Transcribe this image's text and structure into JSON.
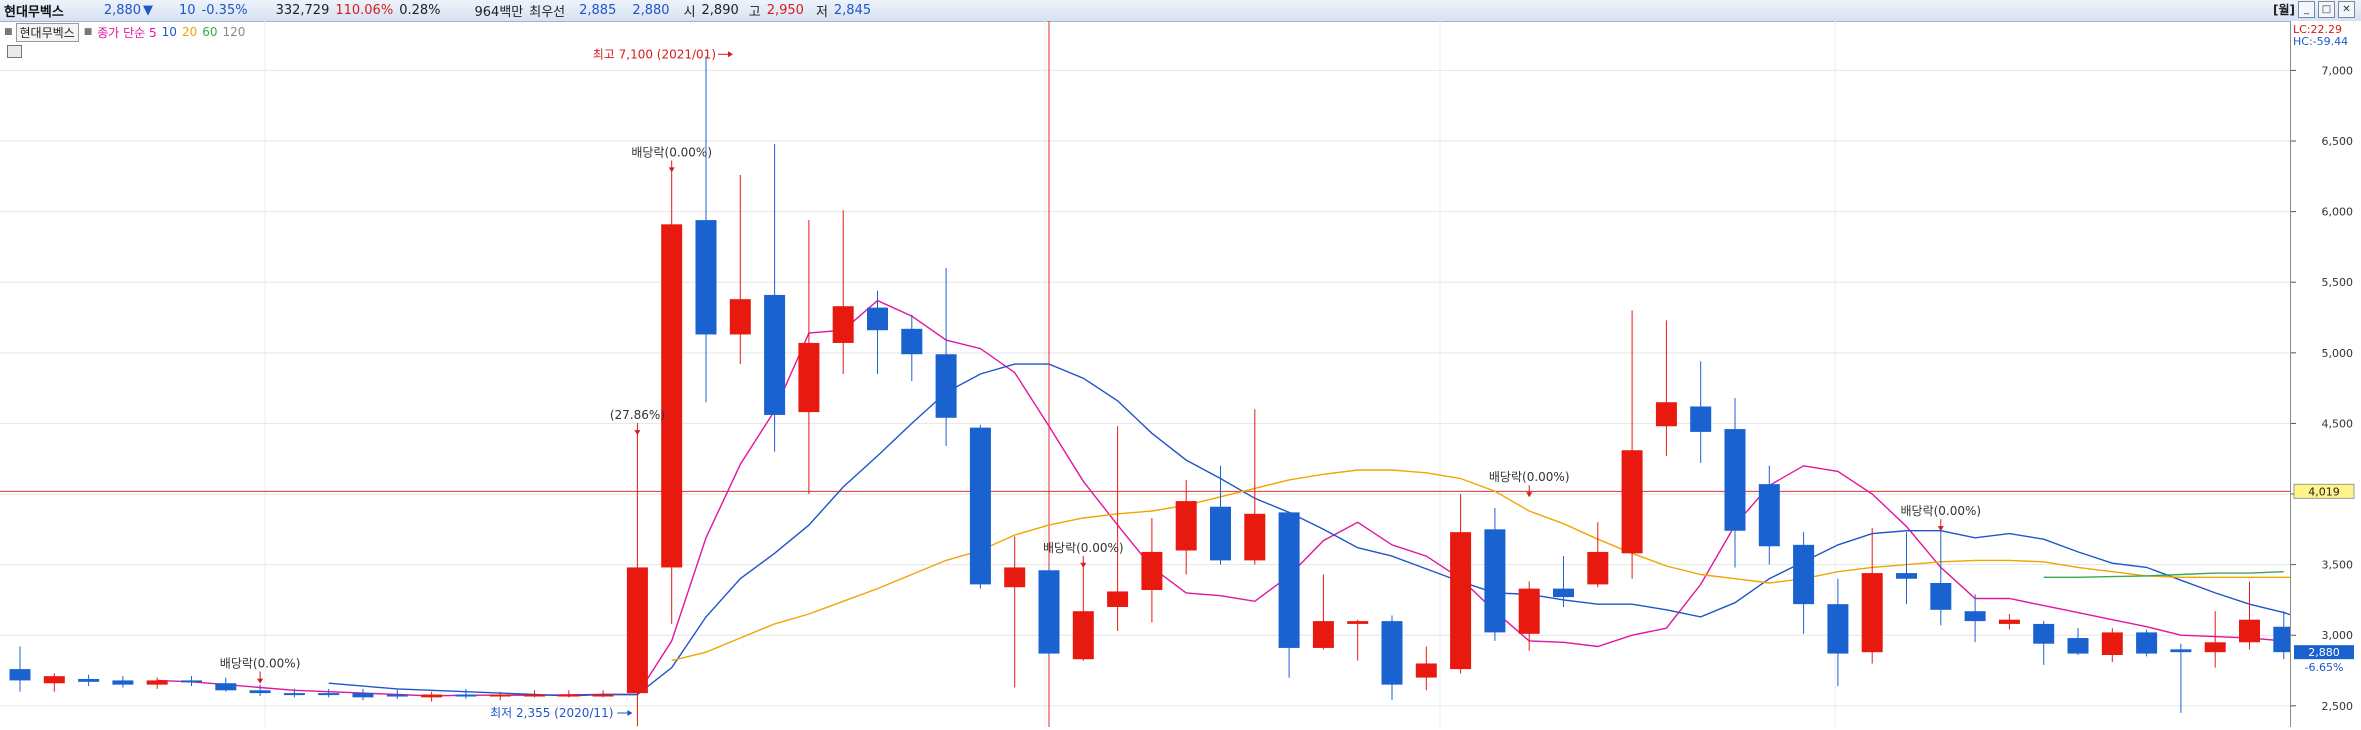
{
  "header": {
    "symbol": "현대무벡스",
    "price": "2,880",
    "direction_icon": "down-triangle-icon",
    "direction_glyph": "▼",
    "change": "10",
    "change_pct": "-0.35%",
    "volume": "332,729",
    "volume_ratio": "110.06%",
    "turnover": "0.28%",
    "amount": "964백만",
    "best_ask_label": "최우선",
    "best_ask": "2,885",
    "best_bid": "2,880",
    "open_label": "시",
    "open": "2,890",
    "high_label": "고",
    "high": "2,950",
    "low_label": "저",
    "low": "2,845",
    "period_button": "[월]",
    "window_buttons": [
      "_",
      "□",
      "✕"
    ]
  },
  "legend": {
    "symbol_tag": "현대무벡스",
    "ma_label": "종가 단순 5",
    "ma_periods": [
      "10",
      "20",
      "60",
      "120"
    ],
    "colors": {
      "ma5": "#e2159f",
      "ma10": "#1f55c8",
      "ma20": "#f0a500",
      "ma60": "#3aa84a",
      "ma120": "#8a8a8a"
    }
  },
  "axis_info": {
    "lc": "LC:22.29",
    "hc": "HC:-59.44"
  },
  "current_price_tag": {
    "value": "2,880",
    "pct": "-6.65%"
  },
  "crosshair_tag": "4,019",
  "chart_data": {
    "type": "candlestick",
    "period": "monthly",
    "ylim": [
      2350,
      7350
    ],
    "yticks": [
      "2,500",
      "3,000",
      "3,500",
      "4,000",
      "4,500",
      "5,000",
      "5,500",
      "6,000",
      "6,500",
      "7,000"
    ],
    "ytick_values": [
      2500,
      3000,
      3500,
      4000,
      4500,
      5000,
      5500,
      6000,
      6500,
      7000
    ],
    "up_color": "#e8190f",
    "down_color": "#1a62d0",
    "candles": [
      {
        "o": 2760,
        "h": 2920,
        "l": 2600,
        "c": 2680
      },
      {
        "o": 2660,
        "h": 2730,
        "l": 2600,
        "c": 2710
      },
      {
        "o": 2690,
        "h": 2720,
        "l": 2640,
        "c": 2670
      },
      {
        "o": 2680,
        "h": 2710,
        "l": 2630,
        "c": 2650
      },
      {
        "o": 2650,
        "h": 2700,
        "l": 2620,
        "c": 2680
      },
      {
        "o": 2680,
        "h": 2710,
        "l": 2640,
        "c": 2670
      },
      {
        "o": 2660,
        "h": 2700,
        "l": 2600,
        "c": 2610
      },
      {
        "o": 2610,
        "h": 2650,
        "l": 2570,
        "c": 2590
      },
      {
        "o": 2590,
        "h": 2620,
        "l": 2560,
        "c": 2580
      },
      {
        "o": 2590,
        "h": 2620,
        "l": 2560,
        "c": 2580
      },
      {
        "o": 2590,
        "h": 2620,
        "l": 2540,
        "c": 2560
      },
      {
        "o": 2580,
        "h": 2620,
        "l": 2550,
        "c": 2570
      },
      {
        "o": 2560,
        "h": 2600,
        "l": 2530,
        "c": 2580
      },
      {
        "o": 2580,
        "h": 2620,
        "l": 2550,
        "c": 2570
      },
      {
        "o": 2570,
        "h": 2600,
        "l": 2540,
        "c": 2580
      },
      {
        "o": 2580,
        "h": 2610,
        "l": 2560,
        "c": 2580
      },
      {
        "o": 2580,
        "h": 2610,
        "l": 2560,
        "c": 2580
      },
      {
        "o": 2580,
        "h": 2610,
        "l": 2560,
        "c": 2580
      },
      {
        "o": 2590,
        "h": 4450,
        "l": 2355,
        "c": 3480
      },
      {
        "o": 3480,
        "h": 6300,
        "l": 3080,
        "c": 5910
      },
      {
        "o": 5940,
        "h": 7100,
        "l": 4650,
        "c": 5130
      },
      {
        "o": 5130,
        "h": 6260,
        "l": 4920,
        "c": 5380
      },
      {
        "o": 5410,
        "h": 6480,
        "l": 4300,
        "c": 4560
      },
      {
        "o": 4580,
        "h": 5940,
        "l": 4000,
        "c": 5070
      },
      {
        "o": 5070,
        "h": 6010,
        "l": 4850,
        "c": 5330
      },
      {
        "o": 5320,
        "h": 5440,
        "l": 4850,
        "c": 5160
      },
      {
        "o": 5170,
        "h": 5270,
        "l": 4800,
        "c": 4990
      },
      {
        "o": 4990,
        "h": 5600,
        "l": 4340,
        "c": 4540
      },
      {
        "o": 4470,
        "h": 4490,
        "l": 3330,
        "c": 3360
      },
      {
        "o": 3340,
        "h": 3700,
        "l": 2630,
        "c": 3480
      },
      {
        "o": 3460,
        "h": 3470,
        "l": 2850,
        "c": 2870
      },
      {
        "o": 2830,
        "h": 3500,
        "l": 2820,
        "c": 3170
      },
      {
        "o": 3200,
        "h": 4480,
        "l": 3030,
        "c": 3310
      },
      {
        "o": 3320,
        "h": 3830,
        "l": 3090,
        "c": 3590
      },
      {
        "o": 3600,
        "h": 4100,
        "l": 3430,
        "c": 3950
      },
      {
        "o": 3910,
        "h": 4200,
        "l": 3500,
        "c": 3530
      },
      {
        "o": 3530,
        "h": 4600,
        "l": 3500,
        "c": 3860
      },
      {
        "o": 3870,
        "h": 3870,
        "l": 2700,
        "c": 2910
      },
      {
        "o": 2910,
        "h": 3430,
        "l": 2900,
        "c": 3100
      },
      {
        "o": 3080,
        "h": 3110,
        "l": 2820,
        "c": 3100
      },
      {
        "o": 3100,
        "h": 3140,
        "l": 2540,
        "c": 2650
      },
      {
        "o": 2700,
        "h": 2920,
        "l": 2610,
        "c": 2800
      },
      {
        "o": 2760,
        "h": 4000,
        "l": 2730,
        "c": 3730
      },
      {
        "o": 3750,
        "h": 3900,
        "l": 2960,
        "c": 3020
      },
      {
        "o": 3010,
        "h": 3380,
        "l": 2890,
        "c": 3330
      },
      {
        "o": 3330,
        "h": 3560,
        "l": 3200,
        "c": 3270
      },
      {
        "o": 3360,
        "h": 3800,
        "l": 3340,
        "c": 3590
      },
      {
        "o": 3580,
        "h": 5300,
        "l": 3400,
        "c": 4310
      },
      {
        "o": 4480,
        "h": 5230,
        "l": 4270,
        "c": 4650
      },
      {
        "o": 4620,
        "h": 4940,
        "l": 4220,
        "c": 4440
      },
      {
        "o": 4460,
        "h": 4680,
        "l": 3480,
        "c": 3740
      },
      {
        "o": 4070,
        "h": 4200,
        "l": 3500,
        "c": 3630
      },
      {
        "o": 3640,
        "h": 3730,
        "l": 3010,
        "c": 3220
      },
      {
        "o": 3220,
        "h": 3400,
        "l": 2640,
        "c": 2870
      },
      {
        "o": 2880,
        "h": 3760,
        "l": 2800,
        "c": 3440
      },
      {
        "o": 3440,
        "h": 3730,
        "l": 3220,
        "c": 3400
      },
      {
        "o": 3370,
        "h": 3760,
        "l": 3070,
        "c": 3180
      },
      {
        "o": 3170,
        "h": 3290,
        "l": 2950,
        "c": 3100
      },
      {
        "o": 3080,
        "h": 3150,
        "l": 3040,
        "c": 3110
      },
      {
        "o": 3080,
        "h": 3100,
        "l": 2790,
        "c": 2940
      },
      {
        "o": 2980,
        "h": 3050,
        "l": 2860,
        "c": 2870
      },
      {
        "o": 2860,
        "h": 3050,
        "l": 2810,
        "c": 3020
      },
      {
        "o": 3020,
        "h": 3040,
        "l": 2850,
        "c": 2870
      },
      {
        "o": 2900,
        "h": 2940,
        "l": 2450,
        "c": 2880
      },
      {
        "o": 2880,
        "h": 3170,
        "l": 2770,
        "c": 2950
      },
      {
        "o": 2950,
        "h": 3380,
        "l": 2900,
        "c": 3110
      },
      {
        "o": 3060,
        "h": 3170,
        "l": 2830,
        "c": 2880
      }
    ],
    "ma_series": [
      {
        "name": "5",
        "color": "#e2159f",
        "start": 4,
        "values": [
          2680,
          2670,
          2650,
          2630,
          2610,
          2600,
          2590,
          2580,
          2570,
          2575,
          2575,
          2575,
          2578,
          2580,
          2580,
          2960,
          3690,
          4210,
          4590,
          5140,
          5160,
          5370,
          5260,
          5090,
          5030,
          4860,
          4480,
          4090,
          3780,
          3480,
          3300,
          3280,
          3240,
          3420,
          3670,
          3800,
          3640,
          3560,
          3400,
          3170,
          2960,
          2950,
          2920,
          3000,
          3050,
          3360,
          3780,
          4060,
          4200,
          4160,
          4000,
          3770,
          3480,
          3260,
          3260,
          3210,
          3160,
          3110,
          3060,
          3000,
          2990,
          2980,
          2960,
          2970,
          3040,
          3020
        ]
      },
      {
        "name": "10",
        "color": "#1f55c8",
        "start": 9,
        "values": [
          2660,
          2640,
          2620,
          2610,
          2600,
          2590,
          2580,
          2570,
          2580,
          2580,
          2770,
          3130,
          3400,
          3580,
          3780,
          4050,
          4270,
          4500,
          4720,
          4850,
          4920,
          4920,
          4820,
          4660,
          4430,
          4240,
          4110,
          3970,
          3870,
          3750,
          3620,
          3560,
          3470,
          3380,
          3300,
          3290,
          3250,
          3220,
          3220,
          3180,
          3130,
          3230,
          3400,
          3520,
          3640,
          3720,
          3740,
          3740,
          3690,
          3720,
          3680,
          3590,
          3510,
          3480,
          3390,
          3300,
          3220,
          3160,
          3080,
          3050,
          3000,
          2950,
          2960,
          2940,
          2940
        ]
      },
      {
        "name": "20",
        "color": "#f0a500",
        "start": 19,
        "values": [
          2820,
          2880,
          2980,
          3080,
          3150,
          3240,
          3330,
          3430,
          3530,
          3600,
          3710,
          3780,
          3830,
          3860,
          3880,
          3920,
          3980,
          4040,
          4100,
          4140,
          4170,
          4170,
          4150,
          4110,
          4020,
          3880,
          3790,
          3680,
          3580,
          3490,
          3430,
          3400,
          3370,
          3400,
          3450,
          3480,
          3500,
          3520,
          3530,
          3530,
          3520,
          3480,
          3450,
          3420,
          3410,
          3410,
          3410,
          3410,
          3410,
          3400,
          3400,
          3390,
          3380,
          3370,
          3360,
          3340,
          3330,
          3320
        ]
      },
      {
        "name": "60",
        "color": "#3aa84a",
        "start": 59,
        "values": [
          3410,
          3410,
          3415,
          3420,
          3430,
          3440,
          3440,
          3450
        ]
      }
    ],
    "annotations": [
      {
        "text": "배당락(0.00%)",
        "candle": 7,
        "price": 2700,
        "color": "#333333"
      },
      {
        "text": "(27.86%)",
        "candle": 18,
        "price": 4460,
        "color": "#333333"
      },
      {
        "text": "배당락(0.00%)",
        "candle": 19,
        "price": 6320,
        "color": "#333333"
      },
      {
        "text": "배당락(0.00%)",
        "candle": 31,
        "price": 3520,
        "color": "#333333"
      },
      {
        "text": "배당락(0.00%)",
        "candle": 44,
        "price": 4020,
        "color": "#333333"
      },
      {
        "text": "배당락(0.00%)",
        "candle": 56,
        "price": 3780,
        "color": "#333333"
      }
    ],
    "high_marker": {
      "text": "최고 7,100 (2021/01)",
      "candle": 20,
      "price": 7100,
      "color": "#d61c1c"
    },
    "low_marker": {
      "text": "최저 2,355 (2020/11)",
      "candle": 18,
      "price": 2355,
      "color": "#1f55c8"
    },
    "crosshair": {
      "candle": 30,
      "price": 4019
    }
  }
}
